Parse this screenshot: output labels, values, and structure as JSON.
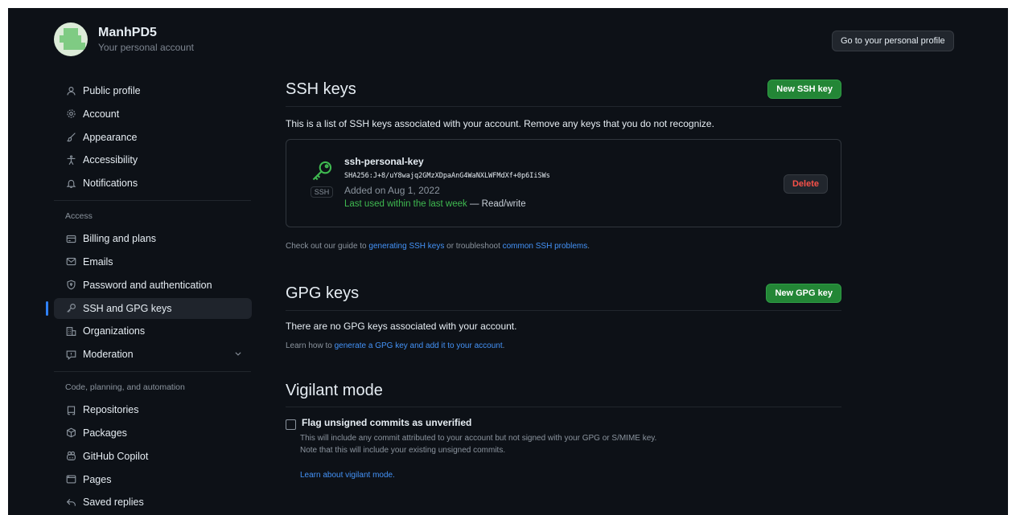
{
  "account": {
    "name": "ManhPD5",
    "subtitle": "Your personal account",
    "profile_button": "Go to your personal profile"
  },
  "sidebar": {
    "items": [
      {
        "label": "Public profile",
        "icon": "person-icon"
      },
      {
        "label": "Account",
        "icon": "gear-icon"
      },
      {
        "label": "Appearance",
        "icon": "paintbrush-icon"
      },
      {
        "label": "Accessibility",
        "icon": "accessibility-icon"
      },
      {
        "label": "Notifications",
        "icon": "bell-icon"
      }
    ],
    "access_label": "Access",
    "access_items": [
      {
        "label": "Billing and plans",
        "icon": "credit-card-icon"
      },
      {
        "label": "Emails",
        "icon": "mail-icon"
      },
      {
        "label": "Password and authentication",
        "icon": "shield-lock-icon"
      },
      {
        "label": "SSH and GPG keys",
        "icon": "key-icon",
        "active": true
      },
      {
        "label": "Organizations",
        "icon": "organization-icon"
      },
      {
        "label": "Moderation",
        "icon": "report-icon",
        "expandable": true
      }
    ],
    "code_label": "Code, planning, and automation",
    "code_items": [
      {
        "label": "Repositories",
        "icon": "repo-icon"
      },
      {
        "label": "Packages",
        "icon": "package-icon"
      },
      {
        "label": "GitHub Copilot",
        "icon": "copilot-icon"
      },
      {
        "label": "Pages",
        "icon": "browser-icon"
      },
      {
        "label": "Saved replies",
        "icon": "reply-icon"
      }
    ]
  },
  "ssh": {
    "title": "SSH keys",
    "new_button": "New SSH key",
    "description": "This is a list of SSH keys associated with your account. Remove any keys that you do not recognize.",
    "key": {
      "name": "ssh-personal-key",
      "fingerprint": "SHA256:J+8/uY8wajq2GMzXDpaAnG4WaNXLWFMdXf+0p6IiSWs",
      "added": "Added on Aug 1, 2022",
      "last_used": "Last used within the last week",
      "access": " — Read/write",
      "badge": "SSH",
      "delete_button": "Delete"
    },
    "guide_prefix": "Check out our guide to ",
    "guide_link1": "generating SSH keys",
    "guide_mid": " or troubleshoot ",
    "guide_link2": "common SSH problems",
    "guide_suffix": "."
  },
  "gpg": {
    "title": "GPG keys",
    "new_button": "New GPG key",
    "empty_text": "There are no GPG keys associated with your account.",
    "learn_prefix": "Learn how to ",
    "learn_link": "generate a GPG key and add it to your account",
    "learn_suffix": "."
  },
  "vigilant": {
    "title": "Vigilant mode",
    "checkbox_label": "Flag unsigned commits as unverified",
    "note1": "This will include any commit attributed to your account but not signed with your GPG or S/MIME key.",
    "note2": "Note that this will include your existing unsigned commits.",
    "learn_link": "Learn about vigilant mode."
  },
  "colors": {
    "background": "#0d1117",
    "accent_green": "#238636",
    "link": "#4493f8",
    "danger": "#f85149"
  }
}
